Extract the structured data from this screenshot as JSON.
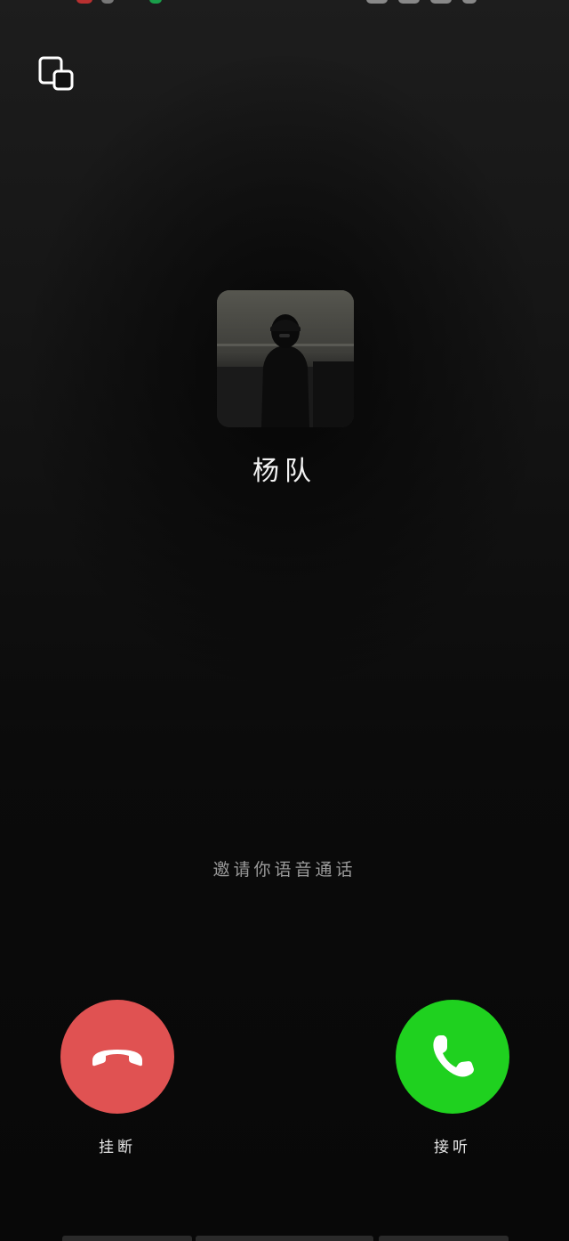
{
  "call": {
    "caller_name": "杨队",
    "invite_text": "邀请你语音通话"
  },
  "actions": {
    "decline_label": "挂断",
    "accept_label": "接听"
  },
  "icons": {
    "minimize": "floating-window-icon",
    "decline": "phone-hangup-icon",
    "accept": "phone-answer-icon"
  },
  "colors": {
    "decline": "#e05252",
    "accept": "#1fd11f",
    "background": "#0b0b0b"
  }
}
